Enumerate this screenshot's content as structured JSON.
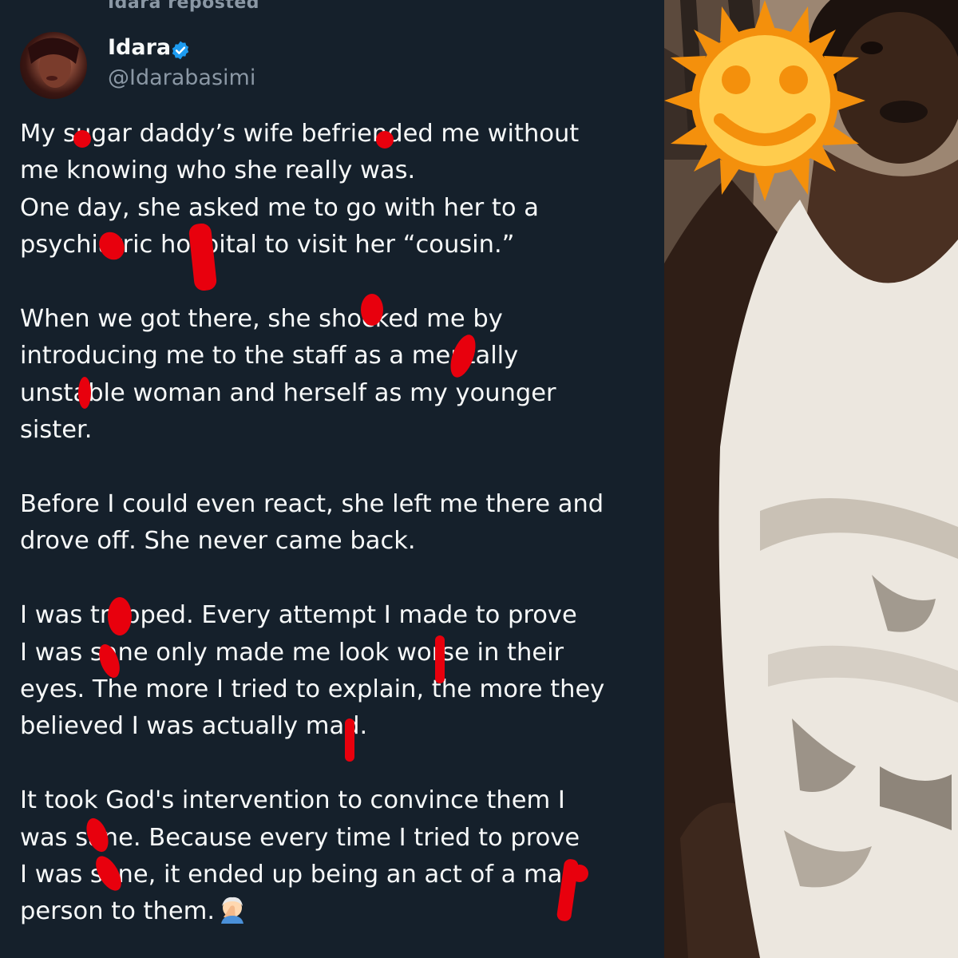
{
  "tweet": {
    "repost_header": "Idara reposted",
    "author": {
      "display_name": "Idara",
      "handle": "@Idarabasimi",
      "verified": true
    },
    "paragraphs": [
      "My sugar daddy’s wife befriended me without\nme knowing who she really was.\nOne day, she asked me to go with her to a\npsychiatric hospital to visit her “cousin.”",
      "When we got there, she shocked me by\nintroducing me to the staff as a mentally\nunstable woman  and herself as my younger\nsister.",
      "Before I could even react, she left me there and\ndrove off. She never came back.",
      "I was trapped. Every attempt I made to prove\nI was sane only made me look worse in their\neyes. The more I tried to explain, the more they\nbelieved I was actually mad.",
      "It took God's intervention to convince them I\nwas sane. Because every time I tried to prove\nI was sane, it ended up being an act of a mad\nperson to them."
    ],
    "trailing_emoji": "facepalm-emoji"
  },
  "photo": {
    "overlay_emoji": "smiling-sun-emoji"
  },
  "colors": {
    "background": "#15202b",
    "text": "#f7f9f9",
    "secondary_text": "#8b98a5",
    "verified_blue": "#1d9bf0",
    "censor_red": "#e8000d"
  }
}
